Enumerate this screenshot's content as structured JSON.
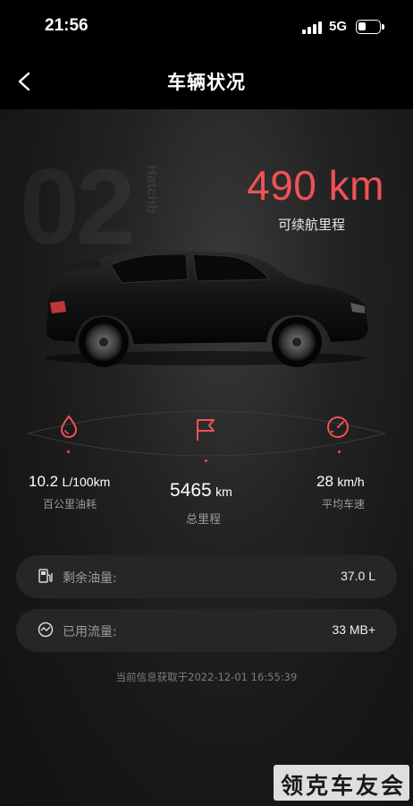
{
  "status_bar": {
    "time": "21:56",
    "network": "5G"
  },
  "nav": {
    "title": "车辆状况",
    "back_icon": "chevron-left-icon"
  },
  "hero": {
    "model_bg": "02",
    "model_bg_sub": "Hatchb",
    "range_value": "490 km",
    "range_label": "可续航里程"
  },
  "stats": [
    {
      "icon": "fuel-drop-icon",
      "value": "10.2",
      "unit": "L/100km",
      "label": "百公里油耗"
    },
    {
      "icon": "flag-icon",
      "value": "5465",
      "unit": "km",
      "label": "总里程"
    },
    {
      "icon": "speedometer-icon",
      "value": "28",
      "unit": "km/h",
      "label": "平均车速"
    }
  ],
  "cards": [
    {
      "icon": "fuel-pump-icon",
      "label": "剩余油量:",
      "value": "37.0 L"
    },
    {
      "icon": "data-usage-icon",
      "label": "已用流量:",
      "value": "33 MB+"
    }
  ],
  "updated_text": "当前信息获取于2022-12-01 16:55:39",
  "watermark": "领克车友会",
  "colors": {
    "accent": "#f05256",
    "background": "#121212",
    "card": "#262626"
  }
}
